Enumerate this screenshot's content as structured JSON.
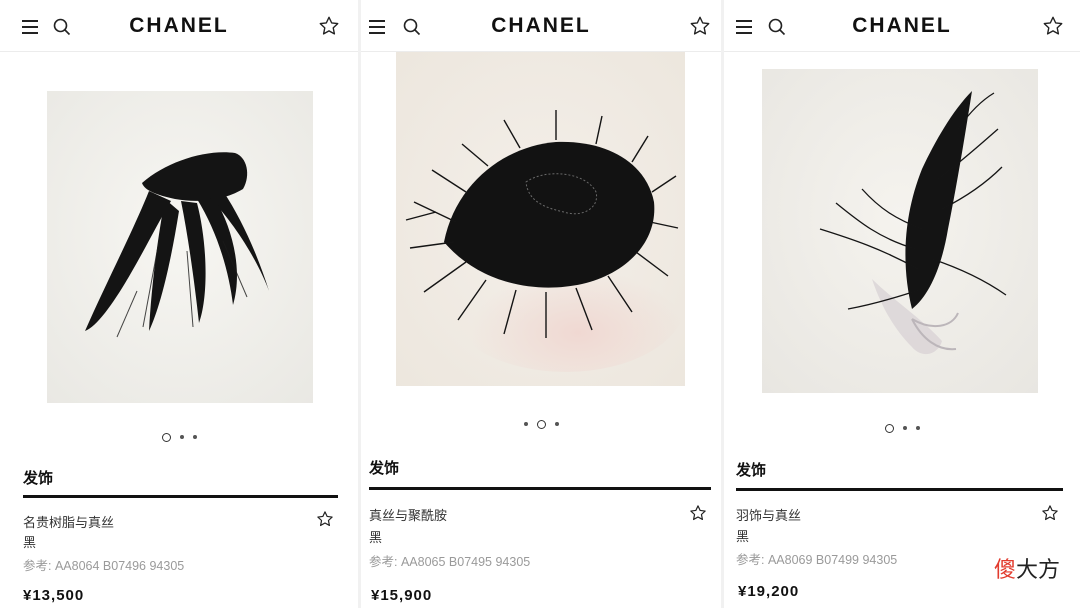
{
  "header": {
    "brand": "CHANEL"
  },
  "icons": {
    "menu": "hamburger-menu-icon",
    "search": "search-icon",
    "favorite": "star-outline-icon"
  },
  "products": [
    {
      "category": "发饰",
      "name": "名贵树脂与真丝",
      "color": "黑",
      "reference": "参考: AA8064 B07496 94305",
      "price": "¥13,500",
      "carousel": {
        "count": 3,
        "active": 0
      }
    },
    {
      "category": "发饰",
      "name": "真丝与聚酰胺",
      "color": "黑",
      "reference": "参考: AA8065 B07495 94305",
      "price": "¥15,900",
      "carousel": {
        "count": 3,
        "active": 1
      }
    },
    {
      "category": "发饰",
      "name": "羽饰与真丝",
      "color": "黑",
      "reference": "参考: AA8069 B07499 94305",
      "price": "¥19,200",
      "carousel": {
        "count": 3,
        "active": 0
      }
    }
  ],
  "watermark": {
    "part1": "傻",
    "part2": "大方"
  },
  "colors": {
    "accent": "#111111",
    "muted_text": "#9a9a9a",
    "watermark_red": "#e23b2e"
  }
}
